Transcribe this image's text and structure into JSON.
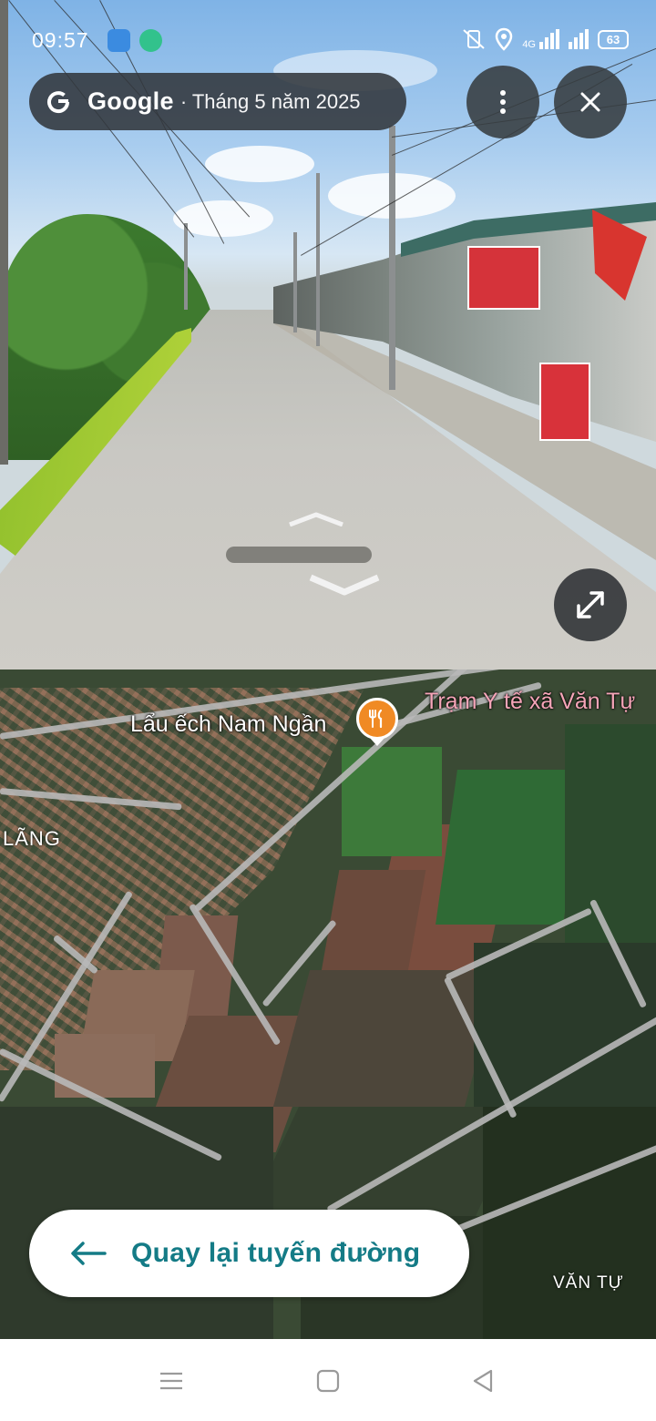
{
  "status_bar": {
    "time": "09:57",
    "network": "4G",
    "battery": "63",
    "icons": [
      "app-icon-blue",
      "chat-icon-green",
      "vibrate-off-icon",
      "location-icon",
      "signal-icon",
      "signal-icon",
      "battery-icon"
    ]
  },
  "street_view": {
    "brand": "Google",
    "date": "· Tháng 5 năm 2025",
    "icons": [
      "google-g-icon",
      "more-vert-icon",
      "close-icon",
      "expand-icon",
      "nav-chevron-icon"
    ]
  },
  "map": {
    "poi_name": "Lẩu ếch Nam Ngần",
    "poi_icon": "restaurant-icon",
    "poi_color": "#f08a24",
    "clinic_name": "Trạm Y tế xã Văn Tự",
    "clinic_color": "#f6a5b8",
    "place_1": "LÃNG",
    "place_2": "VĂN TỰ"
  },
  "back_button": {
    "label": "Quay lại tuyến đường",
    "icon": "arrow-left-icon",
    "color": "#147b86"
  },
  "navbar": {
    "icons": [
      "recent-apps-icon",
      "home-icon",
      "back-icon"
    ]
  }
}
